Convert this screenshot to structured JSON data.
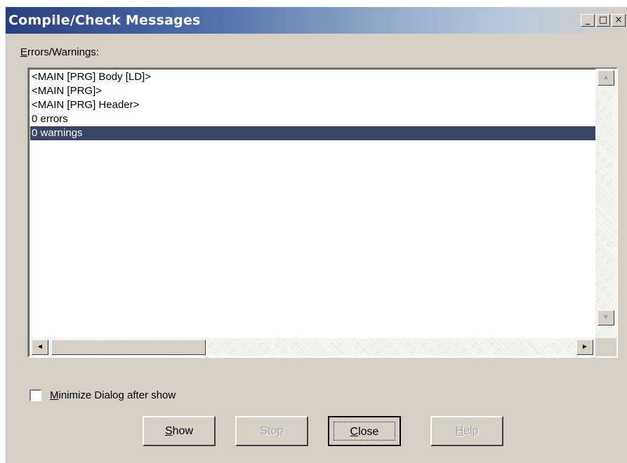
{
  "window": {
    "title": "Compile/Check Messages",
    "controls": {
      "minimize": "_",
      "maximize": "□",
      "close": "×"
    }
  },
  "errors_label": {
    "accel": "E",
    "rest": "rrors/Warnings:"
  },
  "messages": [
    "<MAIN [PRG] Body [LD]>",
    "<MAIN [PRG]>",
    "<MAIN [PRG] Header>",
    "0 errors",
    "0 warnings"
  ],
  "selected_message_index": 4,
  "scrollbar": {
    "up": "▲",
    "down": "▼",
    "left": "◄",
    "right": "►"
  },
  "minimize_checkbox": {
    "checked": false,
    "label_accel": "M",
    "label_rest": "inimize  Dialog after show"
  },
  "buttons": {
    "show": {
      "accel": "S",
      "rest": "how",
      "enabled": true
    },
    "stop": {
      "pre": "Sto",
      "accel": "p",
      "enabled": false
    },
    "close": {
      "accel": "C",
      "rest": "lose",
      "enabled": true,
      "default": true
    },
    "help": {
      "accel": "H",
      "rest": "elp",
      "enabled": false
    }
  },
  "colors": {
    "dialog_bg": "#d4d0c8",
    "title_gradient_start": "#2a3f7e",
    "selection_bg": "#3a4466"
  }
}
